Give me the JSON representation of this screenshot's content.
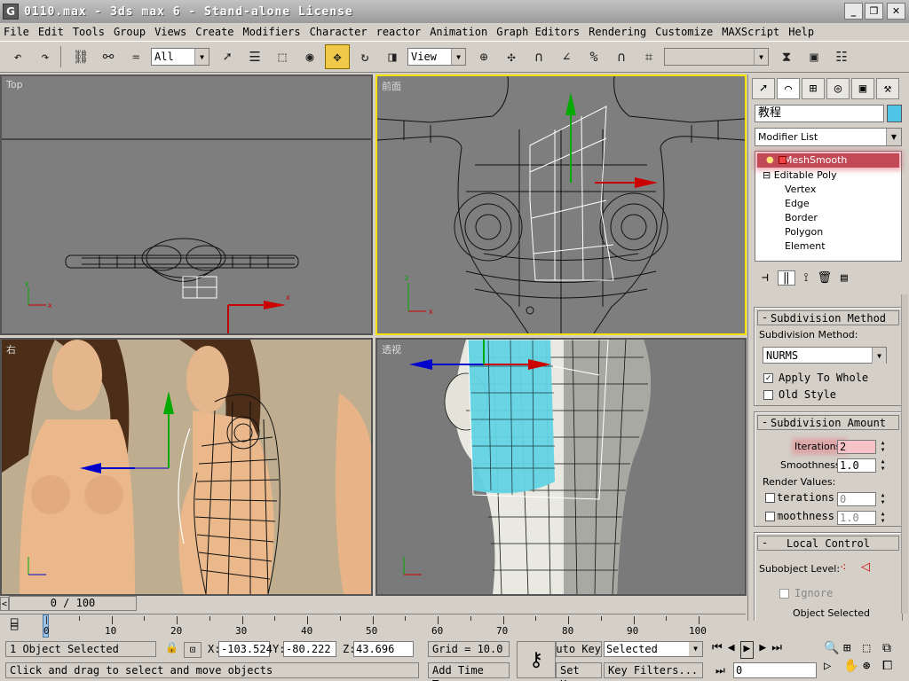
{
  "app": {
    "title": "0110.max - 3ds max 6 - Stand-alone License",
    "icon_letter": "G",
    "window_buttons": [
      "_",
      "❐",
      "✕"
    ]
  },
  "menubar": {
    "items": [
      "File",
      "Edit",
      "Tools",
      "Group",
      "Views",
      "Create",
      "Modifiers",
      "Character",
      "reactor",
      "Animation",
      "Graph Editors",
      "Rendering",
      "Customize",
      "MAXScript",
      "Help"
    ]
  },
  "toolbar": {
    "selection_filter": "All",
    "reference_coord": "View",
    "named_selection": ""
  },
  "viewports": {
    "top": {
      "label": "Top"
    },
    "front": {
      "label": "前面"
    },
    "right": {
      "label": "右"
    },
    "persp": {
      "label": "透视"
    }
  },
  "command_panel": {
    "tab_icons": [
      "create-icon",
      "modify-icon",
      "hierarchy-icon",
      "motion-icon",
      "display-icon",
      "utilities-icon"
    ],
    "object_name": "教程",
    "object_color": "#4fc6e8",
    "modifier_list_label": "Modifier List",
    "stack": {
      "modifier": "MeshSmooth",
      "base": "Editable Poly",
      "subobjects": [
        "Vertex",
        "Edge",
        "Border",
        "Polygon",
        "Element"
      ]
    },
    "subdivision_method": {
      "title": "Subdivision Method",
      "method_label": "Subdivision Method:",
      "method_value": "NURMS",
      "apply_to_whole": "Apply To Whole",
      "apply_to_whole_checked": true,
      "old_style": "Old Style",
      "old_style_checked": false
    },
    "subdivision_amount": {
      "title": "Subdivision Amount",
      "iterations_label": "Iterations:",
      "iterations_value": "2",
      "smoothness_label": "Smoothness:",
      "smoothness_value": "1.0",
      "render_values_label": "Render Values:",
      "render_iterations_label": "Iterations:",
      "render_iterations_value": "0",
      "render_smoothness_label": "Smoothness:",
      "render_smoothness_value": "1.0"
    },
    "local_control": {
      "title": "Local Control",
      "subobject_level_label": "Subobject Level:",
      "ignore_label": "Ignore",
      "object_selected": "Object Selected"
    }
  },
  "timeline": {
    "frame_display": "0 / 100",
    "ticks": [
      "0",
      "10",
      "20",
      "30",
      "40",
      "50",
      "60",
      "70",
      "80",
      "90",
      "100"
    ]
  },
  "status": {
    "selection_info": "1 Object Selected",
    "prompt": "Click and drag to select and move objects",
    "x_label": "X:",
    "x_value": "-103.524",
    "y_label": "Y:",
    "y_value": "-80.222",
    "z_label": "Z:",
    "z_value": "43.696",
    "grid": "Grid = 10.0",
    "add_time_tag": "Add Time Tag",
    "auto_key": "Auto Key",
    "set_key": "Set Key",
    "key_mode": "Selected",
    "key_filters": "Key Filters...",
    "current_frame": "0"
  },
  "colors": {
    "viewport_bg": "#7e7e7e",
    "active_viewport_border": "#f3e100",
    "highlight": "#c24a57",
    "cyan_selection": "#62d4e4"
  }
}
